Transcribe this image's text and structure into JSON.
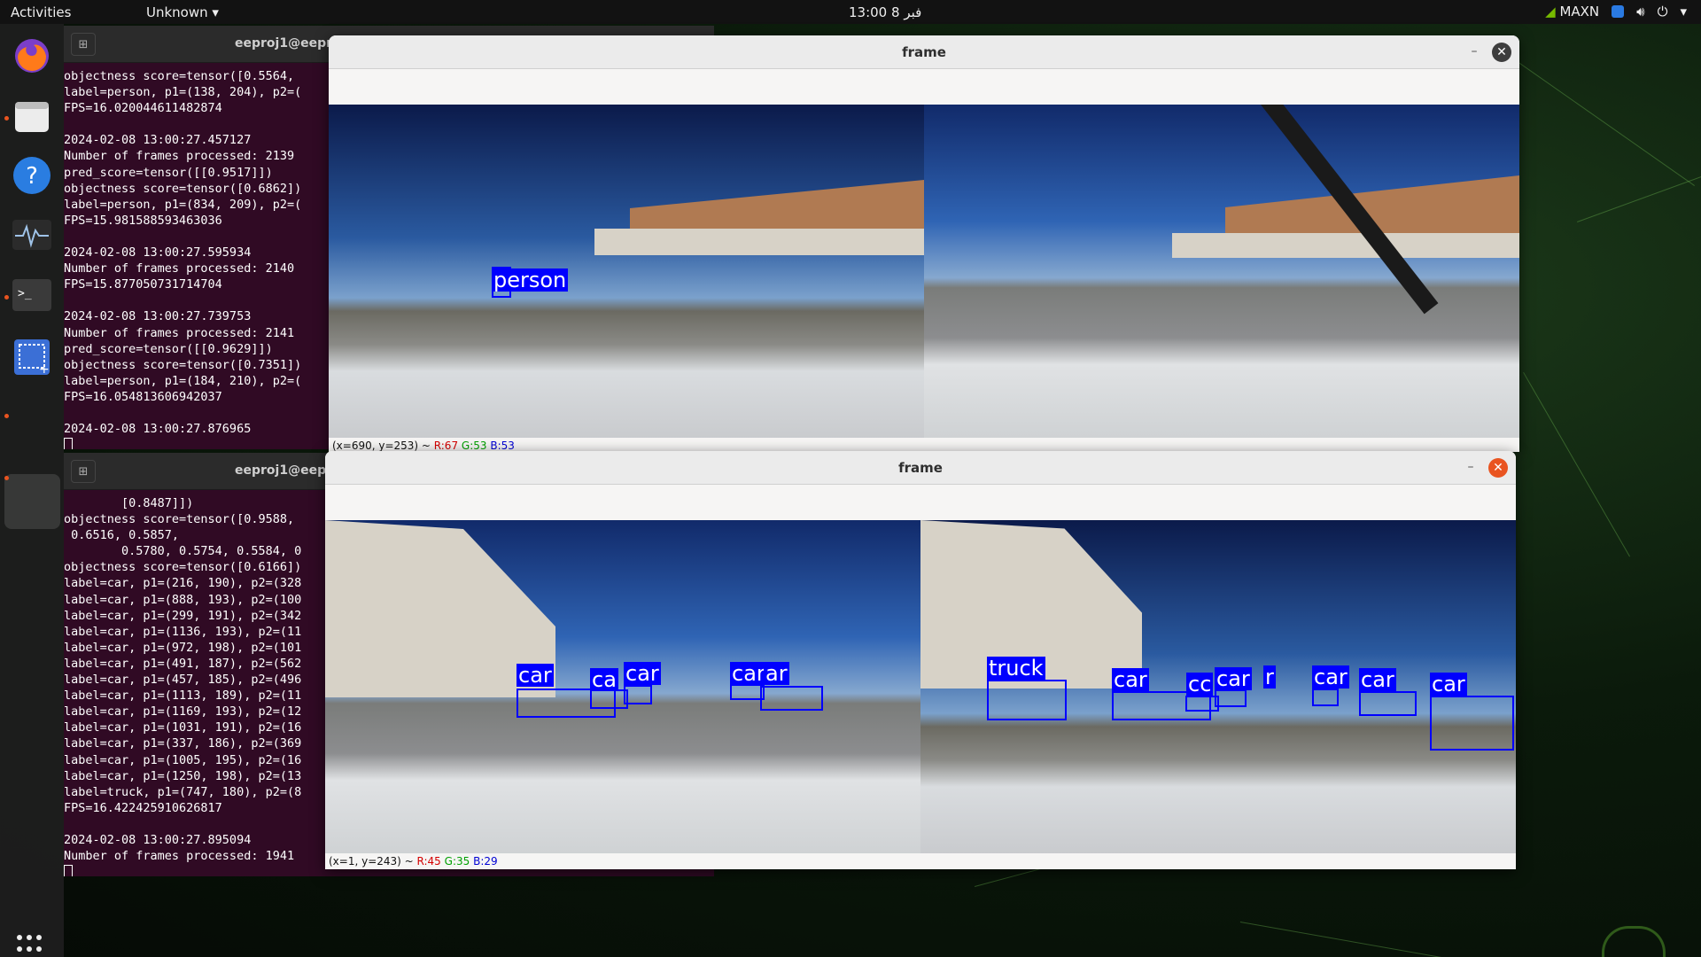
{
  "topbar": {
    "activities": "Activities",
    "app_menu": "Unknown",
    "clock": "13:00  فبر 8",
    "tray_label": "MAXN"
  },
  "dock": {
    "items": [
      "firefox-icon",
      "files-icon",
      "help-icon",
      "system-monitor-icon",
      "terminal-icon",
      "screenshot-icon"
    ],
    "show_apps": "show-applications-icon"
  },
  "terminal_top": {
    "title": "eeproj1@eepr",
    "lines": [
      "objectness score=tensor([0.5564,",
      "label=person, p1=(138, 204), p2=(",
      "FPS=16.020044611482874",
      "",
      "2024-02-08 13:00:27.457127",
      "Number of frames processed: 2139",
      "pred_score=tensor([[0.9517]])",
      "objectness score=tensor([0.6862])",
      "label=person, p1=(834, 209), p2=(",
      "FPS=15.981588593463036",
      "",
      "2024-02-08 13:00:27.595934",
      "Number of frames processed: 2140",
      "FPS=15.877050731714704",
      "",
      "2024-02-08 13:00:27.739753",
      "Number of frames processed: 2141",
      "pred_score=tensor([[0.9629]])",
      "objectness score=tensor([0.7351])",
      "label=person, p1=(184, 210), p2=(",
      "FPS=16.054813606942037",
      "",
      "2024-02-08 13:00:27.876965"
    ]
  },
  "terminal_bottom": {
    "title": "eeproj1@eepr",
    "lines": [
      "        [0.8487]])",
      "objectness score=tensor([0.9588,",
      " 0.6516, 0.5857,",
      "        0.5780, 0.5754, 0.5584, 0",
      "objectness score=tensor([0.6166])",
      "label=car, p1=(216, 190), p2=(328",
      "label=car, p1=(888, 193), p2=(100",
      "label=car, p1=(299, 191), p2=(342",
      "label=car, p1=(1136, 193), p2=(11",
      "label=car, p1=(972, 198), p2=(101",
      "label=car, p1=(491, 187), p2=(562",
      "label=car, p1=(457, 185), p2=(496",
      "label=car, p1=(1113, 189), p2=(11",
      "label=car, p1=(1169, 193), p2=(12",
      "label=car, p1=(1031, 191), p2=(16",
      "label=car, p1=(337, 186), p2=(369",
      "label=car, p1=(1005, 195), p2=(16",
      "label=car, p1=(1250, 198), p2=(13",
      "label=truck, p1=(747, 180), p2=(8",
      "FPS=16.422425910626817",
      "",
      "2024-02-08 13:00:27.895094",
      "Number of frames processed: 1941"
    ]
  },
  "frame_top": {
    "title": "frame",
    "status_prefix": "(x=690, y=253) ~ ",
    "status_r": "R:67",
    "status_g": "G:53",
    "status_b": "B:53",
    "labels": [
      "person"
    ]
  },
  "frame_bottom": {
    "title": "frame",
    "status_prefix": "(x=1, y=243) ~ ",
    "status_r": "R:45",
    "status_g": "G:35",
    "status_b": "B:29",
    "labels": [
      "car",
      "ca",
      "car",
      "car",
      "ar",
      "truck",
      "car",
      "cc",
      "car",
      "r",
      "car",
      "car",
      "car"
    ]
  },
  "colors": {
    "close_active": "#e95420",
    "close_inactive": "#3d3d3d",
    "bbox": "#0000ff",
    "terminal_bg": "#300a24"
  }
}
